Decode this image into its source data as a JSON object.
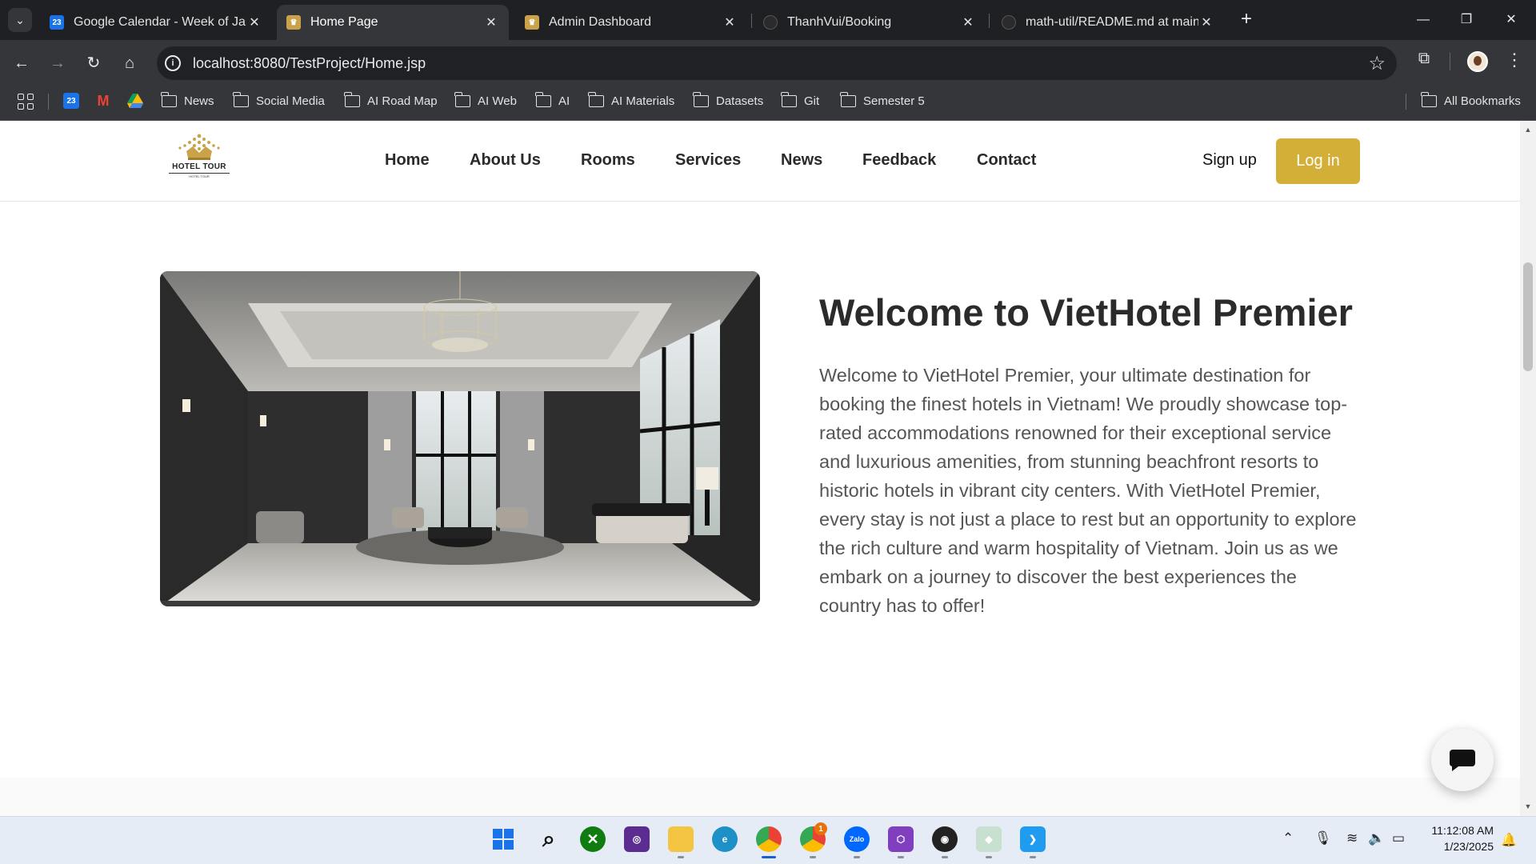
{
  "browser": {
    "tabs": [
      {
        "title": "Google Calendar - Week of Janu",
        "favicon": "calendar-icon",
        "active": false
      },
      {
        "title": "Home Page",
        "favicon": "hotel-icon",
        "active": true
      },
      {
        "title": "Admin Dashboard",
        "favicon": "hotel-icon",
        "active": false
      },
      {
        "title": "ThanhVui/Booking",
        "favicon": "github-icon",
        "active": false
      },
      {
        "title": "math-util/README.md at main",
        "favicon": "github-icon",
        "active": false
      }
    ],
    "address": "localhost:8080/TestProject/Home.jsp",
    "calendar_badge": "23",
    "bookmarks": [
      "News",
      "Social Media",
      "AI Road Map",
      "AI Web",
      "AI",
      "AI Materials",
      "Datasets",
      "Git",
      "Semester 5"
    ],
    "all_bookmarks": "All Bookmarks"
  },
  "site": {
    "logo_text": "HOTEL TOUR",
    "logo_sub": "HOTEL TOUR",
    "nav": [
      "Home",
      "About Us",
      "Rooms",
      "Services",
      "News",
      "Feedback",
      "Contact"
    ],
    "signup_label": "Sign up",
    "login_label": "Log in",
    "accent_color": "#d4af37"
  },
  "hero": {
    "title": "Welcome to VietHotel Premier",
    "body": "Welcome to VietHotel Premier, your ultimate destination for booking the finest hotels in Vietnam! We proudly showcase top-rated accommodations renowned for their exceptional service and luxurious amenities, from stunning beachfront resorts to historic hotels in vibrant city centers. With VietHotel Premier, every stay is not just a place to rest but an opportunity to explore the rich culture and warm hospitality of Vietnam. Join us as we embark on a journey to discover the best experiences the country has to offer!"
  },
  "taskbar": {
    "time": "11:12:08 AM",
    "date": "1/23/2025",
    "chrome_badge": "1",
    "zalo_label": "Zalo"
  }
}
